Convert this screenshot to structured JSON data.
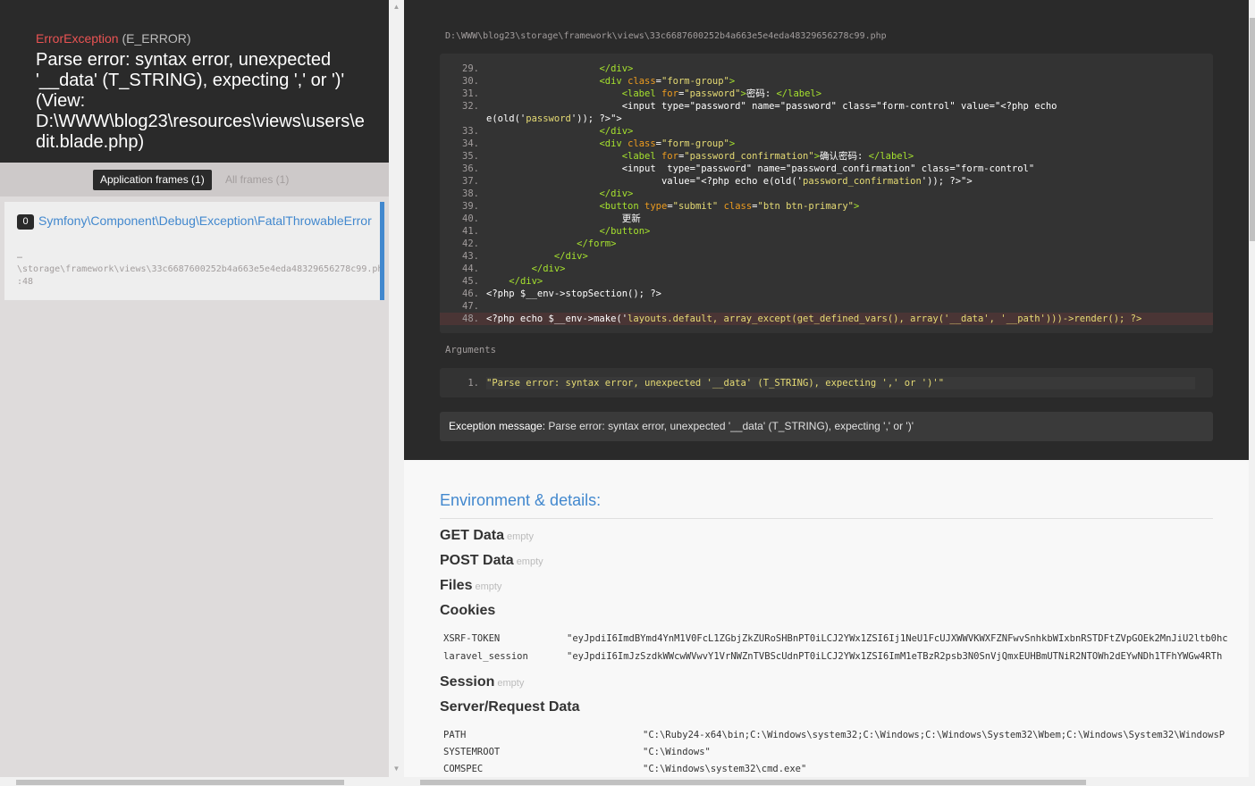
{
  "header": {
    "exception_class": "ErrorException",
    "exception_type": "(E_ERROR)",
    "message": "Parse error: syntax error, unexpected '__data' (T_STRING), expecting ',' or ')' (View: D:\\WWW\\blog23\\resources\\views\\users\\edit.blade.php)"
  },
  "frame_tabs": {
    "application": "Application frames (1)",
    "all": "All frames (1)"
  },
  "frame": {
    "index": "0",
    "class": "Symfony\\Component\\Debug\\Exception\\FatalThrowableError",
    "dots": "…",
    "file": "\\storage\\framework\\views\\33c6687600252b4a663e5e4eda48329656278c99.php",
    "line": ":48"
  },
  "code_view": {
    "file_path": "D:\\WWW\\blog23\\storage\\framework\\views\\33c6687600252b4a663e5e4eda48329656278c99.php"
  },
  "arguments": {
    "title": "Arguments",
    "items": [
      "\"Parse error: syntax error, unexpected '__data' (T_STRING), expecting ',' or ')'\""
    ]
  },
  "exception_message": {
    "label": "Exception message:",
    "text": "Parse error: syntax error, unexpected '__data' (T_STRING), expecting ',' or ')'"
  },
  "env": {
    "title": "Environment & details:",
    "empty": "empty",
    "get": "GET Data",
    "post": "POST Data",
    "files": "Files",
    "cookies": "Cookies",
    "session": "Session",
    "server": "Server/Request Data",
    "cookie_rows": [
      {
        "k": "XSRF-TOKEN",
        "v": "\"eyJpdiI6ImdBYmd4YnM1V0FcL1ZGbjZkZURoSHBnPT0iLCJ2YWx1ZSI6Ij1NeU1FcUJXWWVKWXFZNFwvSnhkbWIxbnRSTDFtZVpGOEk2MnJiU2ltb0hc"
      },
      {
        "k": "laravel_session",
        "v": "\"eyJpdiI6ImJzSzdkWWcwWVwvY1VrNWZnTVBScUdnPT0iLCJ2YWx1ZSI6ImM1eTBzR2psb3N0SnVjQmxEUHBmUTNiR2NTOWh2dEYwNDh1TFhYWGw4RTh"
      }
    ],
    "server_rows": [
      {
        "k": "PATH",
        "v": "\"C:\\Ruby24-x64\\bin;C:\\Windows\\system32;C:\\Windows;C:\\Windows\\System32\\Wbem;C:\\Windows\\System32\\WindowsP"
      },
      {
        "k": "SYSTEMROOT",
        "v": "\"C:\\Windows\""
      },
      {
        "k": "COMSPEC",
        "v": "\"C:\\Windows\\system32\\cmd.exe\""
      }
    ]
  },
  "code_lines": [
    {
      "n": "29.",
      "html": "                    <span class=\"tg\">&lt;/div&gt;</span>"
    },
    {
      "n": "30.",
      "html": "                    <span class=\"tg\">&lt;div</span> <span class=\"at\">class</span>=<span class=\"st\">\"form-group\"</span><span class=\"tg\">&gt;</span>"
    },
    {
      "n": "31.",
      "html": "                        <span class=\"tg\">&lt;label</span> <span class=\"at\">for</span>=<span class=\"st\">\"password\"</span><span class=\"tg\">&gt;</span>密码: <span class=\"tg\">&lt;/label&gt;</span>"
    },
    {
      "n": "32.",
      "html": "                        &lt;input type=\"password\" name=\"password\" class=\"form-control\" value=\"&lt;?php echo"
    },
    {
      "n": "",
      "html": "e(old('<span class=\"st\">password</span>')); ?&gt;\"&gt;"
    },
    {
      "n": "33.",
      "html": "                    <span class=\"tg\">&lt;/div&gt;</span>"
    },
    {
      "n": "34.",
      "html": "                    <span class=\"tg\">&lt;div</span> <span class=\"at\">class</span>=<span class=\"st\">\"form-group\"</span><span class=\"tg\">&gt;</span>"
    },
    {
      "n": "35.",
      "html": "                        <span class=\"tg\">&lt;label</span> <span class=\"at\">for</span>=<span class=\"st\">\"password_confirmation\"</span><span class=\"tg\">&gt;</span>确认密码: <span class=\"tg\">&lt;/label&gt;</span>"
    },
    {
      "n": "36.",
      "html": "                        &lt;input  type=\"password\" name=\"password_confirmation\" class=\"form-control\""
    },
    {
      "n": "37.",
      "html": "                               value=\"&lt;?php echo e(old('<span class=\"st\">password_confirmation</span>')); ?&gt;\"&gt;"
    },
    {
      "n": "38.",
      "html": "                    <span class=\"tg\">&lt;/div&gt;</span>"
    },
    {
      "n": "39.",
      "html": "                    <span class=\"tg\">&lt;button</span> <span class=\"at\">type</span>=<span class=\"st\">\"submit\"</span> <span class=\"at\">class</span>=<span class=\"st\">\"btn btn-primary\"</span><span class=\"tg\">&gt;</span>"
    },
    {
      "n": "40.",
      "html": "                        更新"
    },
    {
      "n": "41.",
      "html": "                    <span class=\"tg\">&lt;/button&gt;</span>"
    },
    {
      "n": "42.",
      "html": "                <span class=\"tg\">&lt;/form&gt;</span>"
    },
    {
      "n": "43.",
      "html": "            <span class=\"tg\">&lt;/div&gt;</span>"
    },
    {
      "n": "44.",
      "html": "        <span class=\"tg\">&lt;/div&gt;</span>"
    },
    {
      "n": "45.",
      "html": "    <span class=\"tg\">&lt;/div&gt;</span>"
    },
    {
      "n": "46.",
      "html": "&lt;?php $__env-&gt;stopSection(); ?&gt;"
    },
    {
      "n": "47.",
      "html": ""
    },
    {
      "n": "48.",
      "html": "&lt;?php echo $__env-&gt;make('<span class=\"st\">layouts.default, array_except(get_defined_vars(), array('__data', '__path')))-&gt;render(); ?&gt;</span>"
    }
  ]
}
